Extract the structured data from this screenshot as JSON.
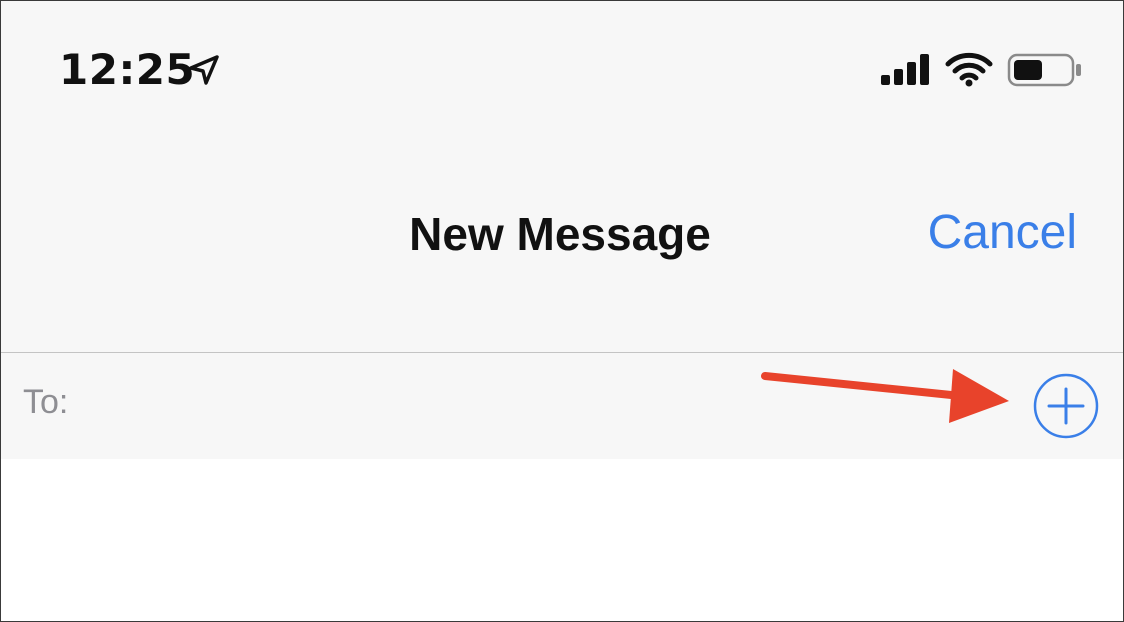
{
  "status_bar": {
    "time": "12:25",
    "icons": [
      "location-arrow-icon",
      "cellular-signal-icon",
      "wifi-icon",
      "battery-icon"
    ]
  },
  "nav_bar": {
    "title": "New Message",
    "cancel_label": "Cancel"
  },
  "compose": {
    "to_label": "To:",
    "to_value": "",
    "add_contact_icon": "plus-circle-icon"
  },
  "annotation": {
    "arrow_icon": "red-arrow-icon",
    "color": "#e8432b"
  },
  "colors": {
    "accent": "#3a7fe8",
    "bar_background": "#f7f7f7",
    "placeholder_gray": "#8e8e93"
  }
}
